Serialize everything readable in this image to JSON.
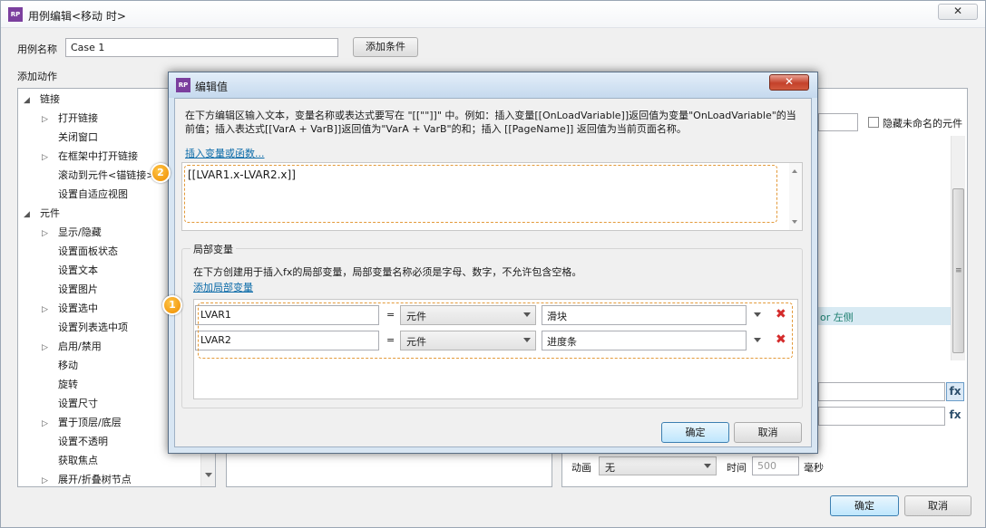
{
  "window": {
    "title": "用例编辑<移动 时>",
    "close_symbol": "✕"
  },
  "case": {
    "name_label": "用例名称",
    "name_value": "Case 1",
    "add_condition": "添加条件"
  },
  "left_panel": {
    "title": "添加动作",
    "items": [
      {
        "label": "链接",
        "type": "group-open"
      },
      {
        "label": "打开链接",
        "type": "child-collapsed"
      },
      {
        "label": "关闭窗口",
        "type": "child"
      },
      {
        "label": "在框架中打开链接",
        "type": "child-collapsed"
      },
      {
        "label": "滚动到元件<锚链接>",
        "type": "child"
      },
      {
        "label": "设置自适应视图",
        "type": "child"
      },
      {
        "label": "元件",
        "type": "group-open"
      },
      {
        "label": "显示/隐藏",
        "type": "child-collapsed"
      },
      {
        "label": "设置面板状态",
        "type": "child"
      },
      {
        "label": "设置文本",
        "type": "child"
      },
      {
        "label": "设置图片",
        "type": "child"
      },
      {
        "label": "设置选中",
        "type": "child-collapsed"
      },
      {
        "label": "设置列表选中项",
        "type": "child"
      },
      {
        "label": "启用/禁用",
        "type": "child-collapsed"
      },
      {
        "label": "移动",
        "type": "child"
      },
      {
        "label": "旋转",
        "type": "child"
      },
      {
        "label": "设置尺寸",
        "type": "child"
      },
      {
        "label": "置于顶层/底层",
        "type": "child-collapsed"
      },
      {
        "label": "设置不透明",
        "type": "child"
      },
      {
        "label": "获取焦点",
        "type": "child"
      },
      {
        "label": "展开/折叠树节点",
        "type": "child-collapsed"
      }
    ]
  },
  "right_panel": {
    "hide_unnamed_label": "隐藏未命名的元件",
    "selected_row_text": "or 左侧",
    "fx": "fx",
    "animation_label": "动画",
    "animation_value": "无",
    "time_label": "时间",
    "time_value": "500",
    "ms_label": "毫秒"
  },
  "footer": {
    "ok": "确定",
    "cancel": "取消"
  },
  "modal": {
    "title": "编辑值",
    "instruction": "在下方编辑区输入文本，变量名称或表达式要写在 \"[[\"\"]]\" 中。例如：插入变量[[OnLoadVariable]]返回值为变量\"OnLoadVariable\"的当前值；插入表达式[[VarA + VarB]]返回值为\"VarA + VarB\"的和；插入 [[PageName]] 返回值为当前页面名称。",
    "insert_link": "插入变量或函数...",
    "expression": "[[LVAR1.x-LVAR2.x]]",
    "local_vars_title": "局部变量",
    "local_vars_desc": "在下方创建用于插入fx的局部变量，局部变量名称必须是字母、数字，不允许包含空格。",
    "add_local_var": "添加局部变量",
    "badge_1": "1",
    "badge_2": "2",
    "variables": [
      {
        "name": "LVAR1",
        "eq": "=",
        "type": "元件",
        "target": "滑块"
      },
      {
        "name": "LVAR2",
        "eq": "=",
        "type": "元件",
        "target": "进度条"
      }
    ],
    "ok": "确定",
    "cancel": "取消"
  },
  "colors": {
    "accent_badge": "#f39c12",
    "dashed_highlight": "#e39a3a",
    "delete_red": "#d42b2b",
    "link_blue": "#0a6aa8"
  }
}
